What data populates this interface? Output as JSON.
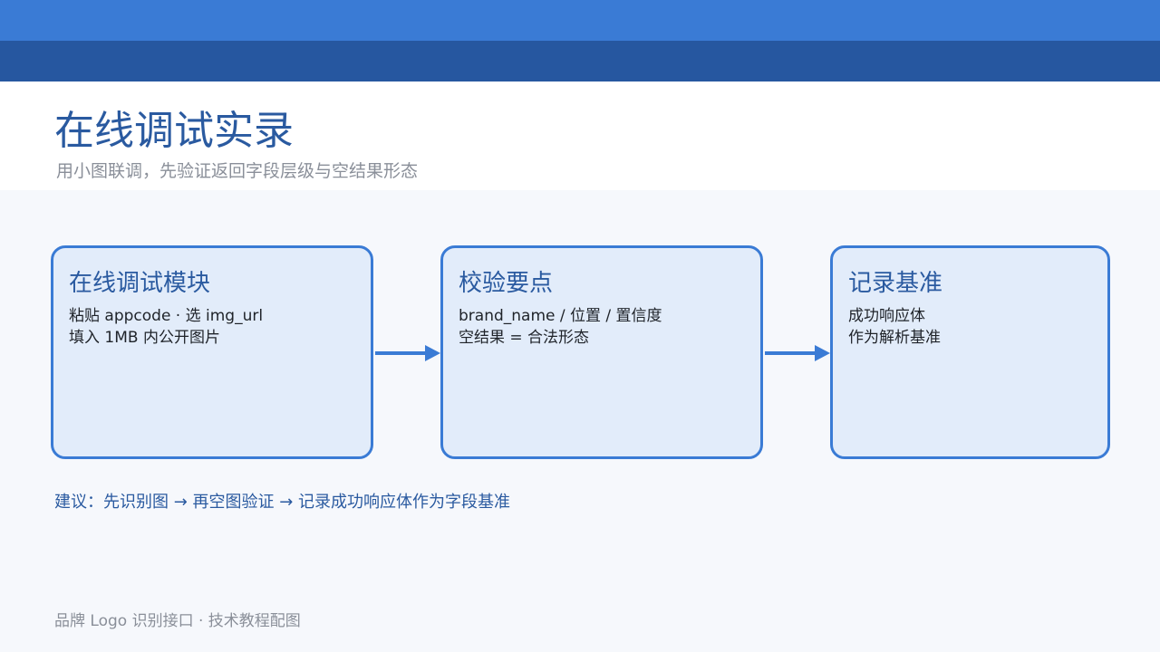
{
  "header": {
    "title": "在线调试实录",
    "subtitle": "用小图联调，先验证返回字段层级与空结果形态"
  },
  "steps": [
    {
      "title": "在线调试模块",
      "lines": [
        "粘贴 appcode · 选 img_url",
        "填入 1MB 内公开图片"
      ]
    },
    {
      "title": "校验要点",
      "lines": [
        "brand_name / 位置 / 置信度",
        "空结果 = 合法形态"
      ]
    },
    {
      "title": "记录基准",
      "lines": [
        "成功响应体",
        "作为解析基准"
      ]
    }
  ],
  "tip": "建议：先识别图 → 再空图验证 → 记录成功响应体作为字段基准",
  "footer": "品牌 Logo 识别接口 · 技术教程配图",
  "colors": {
    "accent": "#3a7bd5",
    "accent_dark": "#2657a0",
    "title_text": "#2a5aa0",
    "box_fill": "#e2ecfa",
    "muted_text": "#8a8f99"
  }
}
